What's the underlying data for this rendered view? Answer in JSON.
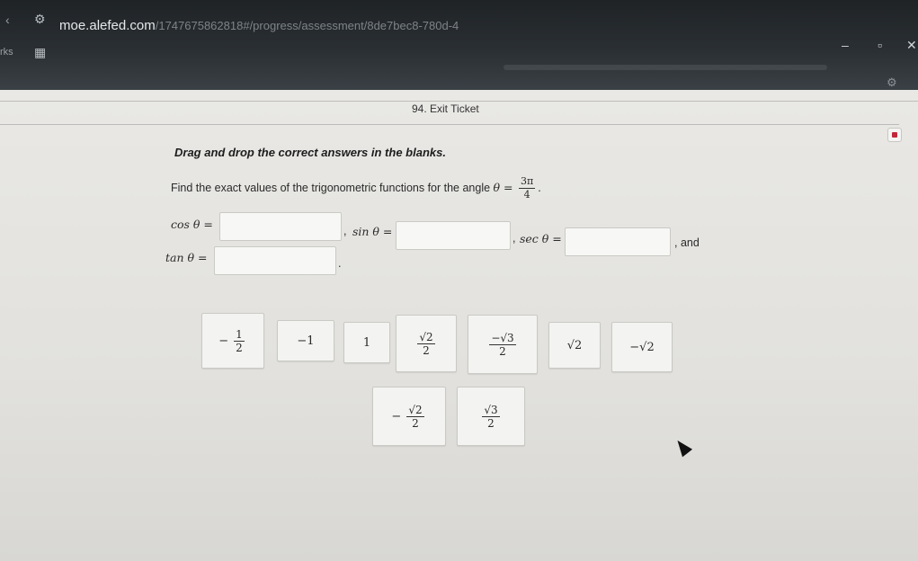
{
  "browser": {
    "url_host": "moe.alefed.com",
    "url_path": "/1747675862818#/progress/assessment/8de7bec8-780d-4",
    "tab_left": "rks"
  },
  "page": {
    "title": "94. Exit Ticket",
    "instruction": "Drag and drop the correct answers in the blanks.",
    "question_prefix": "Find the exact values of the trigonometric functions for the angle",
    "theta_eq": "θ =",
    "angle_num": "3π",
    "angle_den": "4",
    "question_suffix": "."
  },
  "blanks": {
    "cos_label": "cos θ =",
    "sin_label": "sin θ =",
    "sec_label": "sec θ =",
    "tan_label": "tan θ =",
    "sep1": ",",
    "sep2": ",",
    "and_text": ", and",
    "end": "."
  },
  "tiles": {
    "t1_sign": "−",
    "t1_num": "1",
    "t1_den": "2",
    "t2": "−1",
    "t3": "1",
    "t4_num": "√2",
    "t4_den": "2",
    "t5_num": "−√3",
    "t5_den": "2",
    "t6": "√2",
    "t7": "−√2",
    "t8_sign": "−",
    "t8_num": "√2",
    "t8_den": "2",
    "t9_num": "√3",
    "t9_den": "2"
  },
  "colors": {
    "stop_button": "#c2273a"
  }
}
